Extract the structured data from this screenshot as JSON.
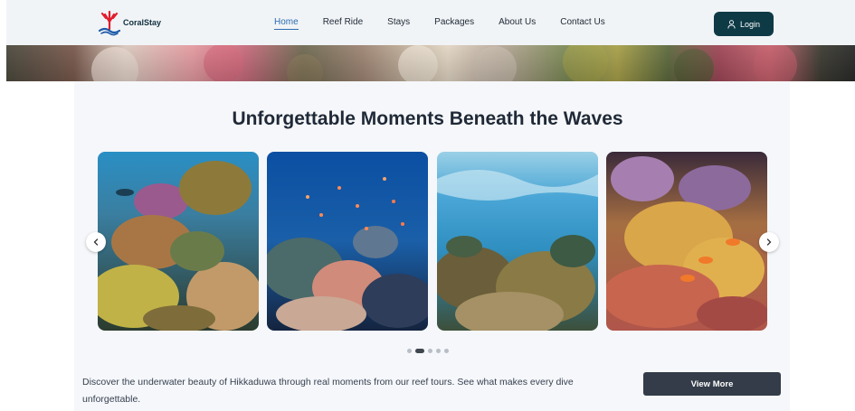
{
  "brand": {
    "name": "CoralStay",
    "mark_color": "#e11d2c",
    "wave_color": "#1e5aa8"
  },
  "nav": {
    "links": [
      {
        "label": "Home",
        "active": true
      },
      {
        "label": "Reef Ride",
        "active": false
      },
      {
        "label": "Stays",
        "active": false
      },
      {
        "label": "Packages",
        "active": false
      },
      {
        "label": "About Us",
        "active": false
      },
      {
        "label": "Contact Us",
        "active": false
      }
    ],
    "login_label": "Login",
    "login_icon": "user-icon"
  },
  "section": {
    "title": "Unforgettable Moments Beneath the Waves",
    "description": "Discover the underwater beauty of Hikkaduwa through real moments from our reef tours. See what makes every dive unforgettable.",
    "view_more_label": "View More"
  },
  "carousel": {
    "images": [
      {
        "icon": "coral-reef-photo"
      },
      {
        "icon": "fish-school-photo"
      },
      {
        "icon": "shallow-reef-photo"
      },
      {
        "icon": "clownfish-anemone-photo"
      }
    ],
    "prev_icon": "chevron-left-icon",
    "next_icon": "chevron-right-icon",
    "dot_count": 5,
    "active_dot": 1
  },
  "colors": {
    "nav_bg": "#f1f4f6",
    "login_bg": "#0e3a46",
    "view_more_bg": "#333c48",
    "active_link": "#2b6cb0"
  }
}
